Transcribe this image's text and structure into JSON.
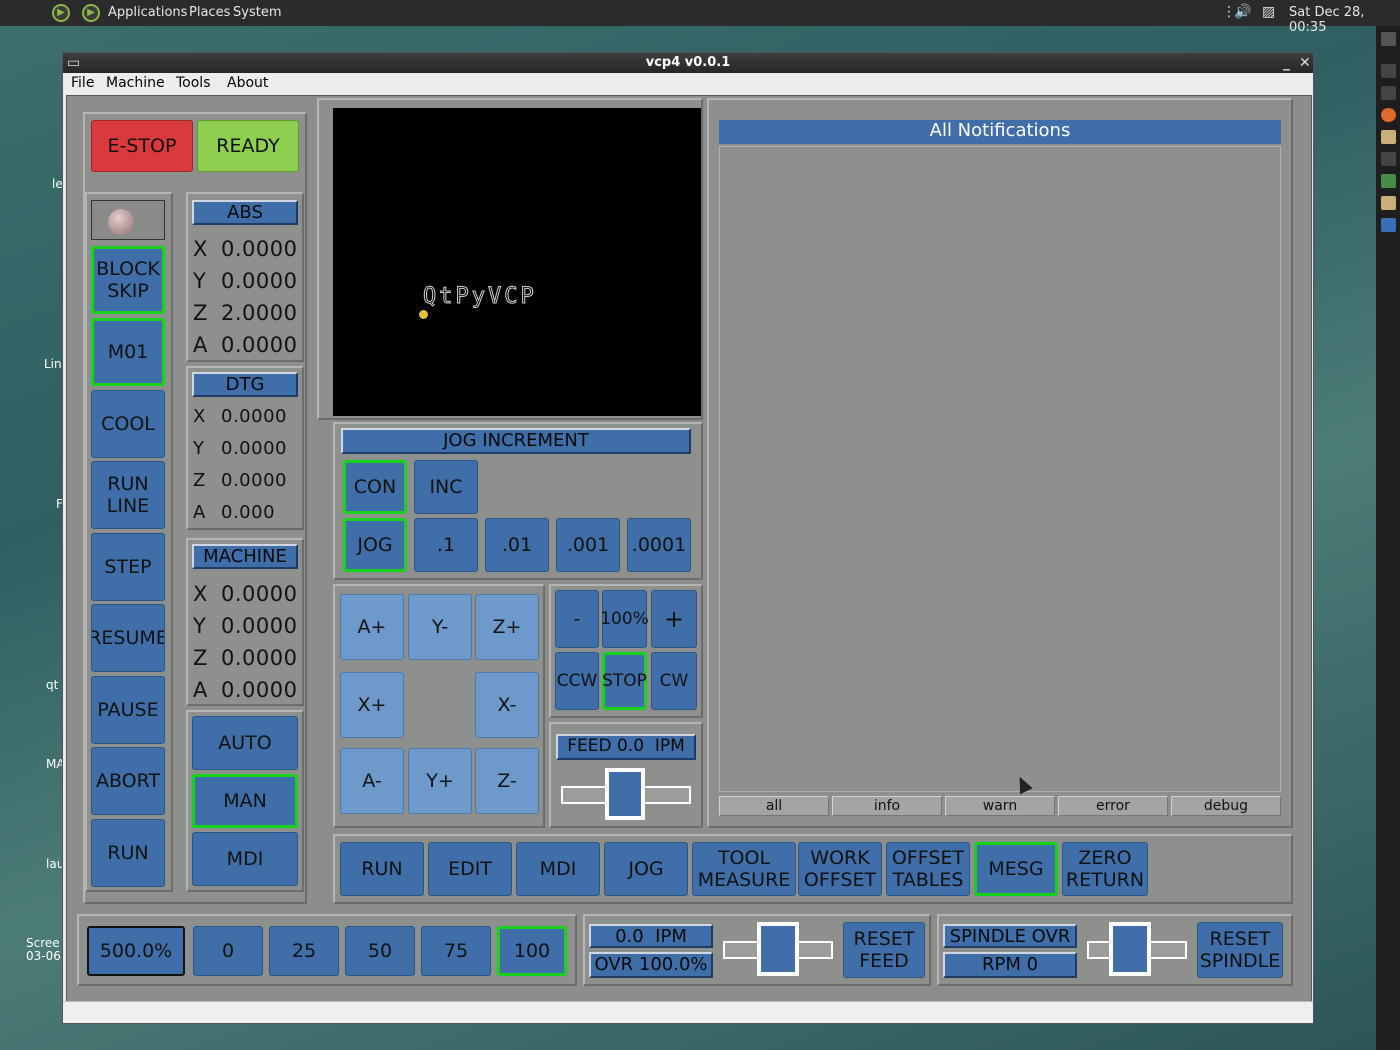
{
  "desktop": {
    "menu": [
      "Applications",
      "Places",
      "System"
    ],
    "clock": "Sat Dec 28, 00:35",
    "labels": [
      "le",
      "Lin",
      "F",
      "qt",
      "MA",
      "lau",
      "Scree\n03-06"
    ]
  },
  "window": {
    "title": "vcp4 v0.0.1",
    "menu": [
      "File",
      "Machine",
      "Tools",
      "About"
    ]
  },
  "top_buttons": {
    "estop": "E-STOP",
    "ready": "READY"
  },
  "left_buttons": [
    "BLOCK\nSKIP",
    "M01",
    "COOL",
    "RUN\nLINE",
    "STEP",
    "RESUME",
    "PAUSE",
    "ABORT",
    "RUN"
  ],
  "dro": {
    "abs": {
      "title": "ABS",
      "rows": [
        [
          "X",
          "0.0000"
        ],
        [
          "Y",
          "0.0000"
        ],
        [
          "Z",
          "2.0000"
        ],
        [
          "A",
          "0.0000"
        ]
      ]
    },
    "dtg": {
      "title": "DTG",
      "rows": [
        [
          "X",
          "0.0000"
        ],
        [
          "Y",
          "0.0000"
        ],
        [
          "Z",
          "0.0000"
        ],
        [
          "A",
          "0.000"
        ]
      ]
    },
    "machine": {
      "title": "MACHINE",
      "rows": [
        [
          "X",
          "0.0000"
        ],
        [
          "Y",
          "0.0000"
        ],
        [
          "Z",
          "0.0000"
        ],
        [
          "A",
          "0.0000"
        ]
      ]
    }
  },
  "modes": [
    "AUTO",
    "MAN",
    "MDI"
  ],
  "preview": {
    "watermark": "QtPyVCP"
  },
  "jog_increment": {
    "title": "JOG INCREMENT",
    "con": "CON",
    "inc": "INC",
    "jog": "JOG",
    "steps": [
      ".1",
      ".01",
      ".001",
      ".0001"
    ]
  },
  "jog_buttons": [
    "A+",
    "Y-",
    "Z+",
    "X+",
    "X-",
    "A-",
    "Y+",
    "Z-"
  ],
  "spindle_ctrl": {
    "minus": "-",
    "pct": "100%",
    "plus": "+",
    "ccw": "CCW",
    "stop": "STOP",
    "cw": "CW"
  },
  "feed_label": "FEED 0.0  IPM",
  "notifications": {
    "title": "All Notifications",
    "tabs": [
      "all",
      "info",
      "warn",
      "error",
      "debug"
    ]
  },
  "bottom_nav": [
    "RUN",
    "EDIT",
    "MDI",
    "JOG",
    "TOOL\nMEASURE",
    "WORK\nOFFSET",
    "OFFSET\nTABLES",
    "MESG",
    "ZERO\nRETURN"
  ],
  "footer": {
    "rapid": "500.0%",
    "rapid_presets": [
      "0",
      "25",
      "50",
      "75",
      "100"
    ],
    "feed_rate": "0.0  IPM",
    "feed_ovr": "OVR 100.0%",
    "reset_feed": "RESET\nFEED",
    "spindle_ovr": "SPINDLE OVR",
    "rpm": "RPM 0",
    "reset_spindle": "RESET\nSPINDLE"
  },
  "colors": {
    "button_blue": "#3f6ea9",
    "estop_red": "#da3a3c",
    "ready_green": "#8ecf4f",
    "active_border": "#17d31b"
  }
}
